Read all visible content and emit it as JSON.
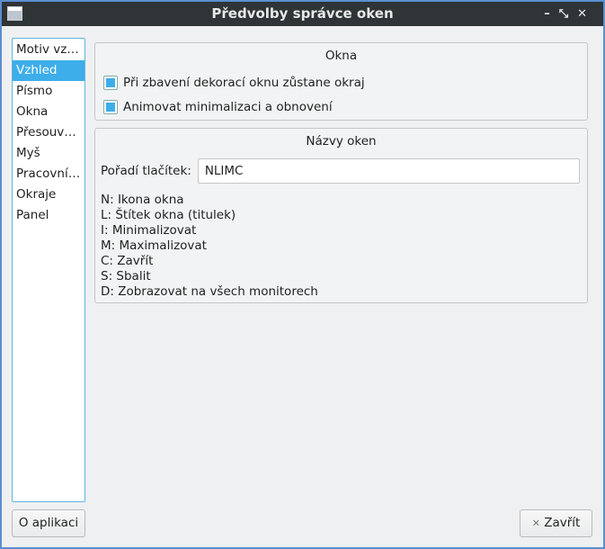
{
  "window": {
    "title": "Předvolby správce oken",
    "controls": [
      "–",
      "⤡",
      "✕"
    ]
  },
  "sidebar": {
    "items": [
      "Motiv vz…",
      "Vzhled",
      "Písmo",
      "Okna",
      "Přesouv…",
      "Myš",
      "Pracovní…",
      "Okraje",
      "Panel"
    ],
    "selected": "Vzhled"
  },
  "okna": {
    "title": "Okna",
    "options": [
      {
        "label": "Při zbavení dekorací oknu zůstane okraj",
        "checked": true
      },
      {
        "label": "Animovat minimalizaci a obnovení",
        "checked": true
      }
    ]
  },
  "nazvy": {
    "title": "Názvy oken",
    "order_label": "Pořadí tlačítek:",
    "order_value": "NLIMC",
    "legend": [
      "N: Ikona okna",
      "L: Štítek okna (titulek)",
      "I: Minimalizovat",
      "M: Maximalizovat",
      "C: Zavřít",
      "S: Sbalit",
      "D: Zobrazovat na všech monitorech"
    ]
  },
  "buttons": {
    "about": "O aplikaci",
    "close_icon": "✕",
    "close": "Zavřít"
  }
}
